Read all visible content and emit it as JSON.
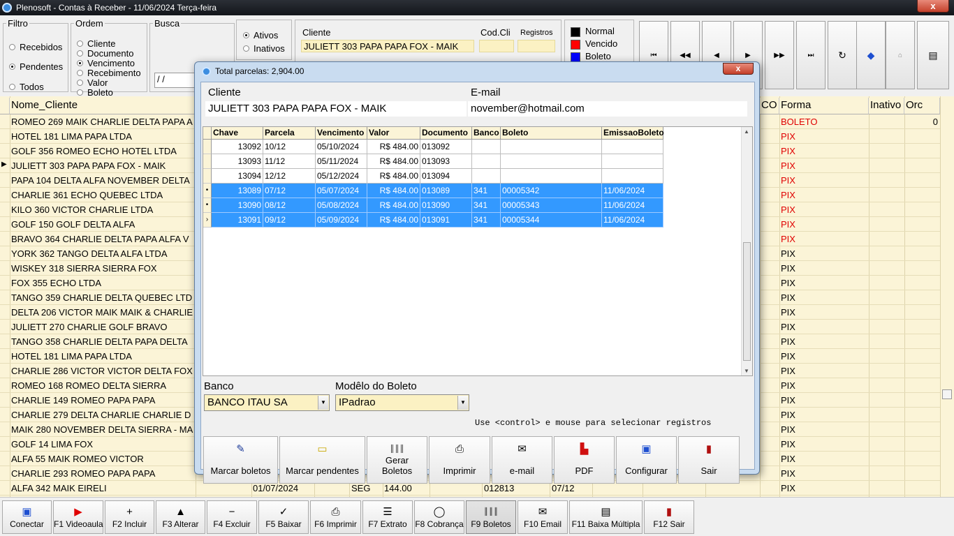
{
  "window": {
    "title": "Plenosoft - Contas à Receber - 11/06/2024 Terça-feira"
  },
  "filtro": {
    "label": "Filtro",
    "options": [
      "Recebidos",
      "Pendentes",
      "Todos"
    ],
    "selected": "Pendentes"
  },
  "ordem": {
    "label": "Ordem",
    "options": [
      "Cliente",
      "Documento",
      "Vencimento",
      "Recebimento",
      "Valor",
      "Boleto"
    ],
    "selected": "Vencimento"
  },
  "busca": {
    "label": "Busca",
    "value": "/ /"
  },
  "status": {
    "options": [
      "Ativos",
      "Inativos"
    ],
    "selected": "Ativos"
  },
  "cliente_panel": {
    "cliente_label": "Cliente",
    "cliente_value": "JULIETT 303 PAPA PAPA FOX - MAIK",
    "codcli_label": "Cod.Cli",
    "registros_label": "Registros"
  },
  "legend": [
    {
      "label": "Normal",
      "color": "#000000"
    },
    {
      "label": "Vencido",
      "color": "#ff0000"
    },
    {
      "label": "Boleto",
      "color": "#0000ff"
    }
  ],
  "main_grid": {
    "headers": {
      "nome": "Nome_Cliente",
      "co": "CO",
      "forma": "Forma",
      "inativo": "Inativo",
      "orc": "Orc"
    },
    "rows": [
      {
        "nome": "ROMEO 269 MAIK CHARLIE DELTA PAPA A",
        "forma": "BOLETO",
        "orc": "0",
        "red": true
      },
      {
        "nome": "HOTEL 181 LIMA PAPA LTDA",
        "forma": "PIX",
        "red": true
      },
      {
        "nome": "GOLF 356 ROMEO ECHO HOTEL LTDA",
        "forma": "PIX",
        "red": true
      },
      {
        "nome": "JULIETT 303 PAPA PAPA FOX - MAIK",
        "forma": "PIX",
        "red": true,
        "current": true
      },
      {
        "nome": "PAPA 104 DELTA ALFA NOVEMBER DELTA",
        "forma": "PIX",
        "red": true
      },
      {
        "nome": "CHARLIE 361 ECHO QUEBEC LTDA",
        "forma": "PIX",
        "red": true
      },
      {
        "nome": "KILO 360 VICTOR CHARLIE LTDA",
        "forma": "PIX",
        "red": true
      },
      {
        "nome": "GOLF 150 GOLF DELTA ALFA",
        "forma": "PIX",
        "red": true
      },
      {
        "nome": "BRAVO 364 CHARLIE DELTA PAPA ALFA V",
        "forma": "PIX",
        "red": true
      },
      {
        "nome": "YORK 362 TANGO DELTA ALFA LTDA",
        "forma": "PIX"
      },
      {
        "nome": "WISKEY 318 SIERRA SIERRA FOX",
        "forma": "PIX"
      },
      {
        "nome": "FOX 355 ECHO LTDA",
        "forma": "PIX"
      },
      {
        "nome": "TANGO 359 CHARLIE DELTA QUEBEC LTD",
        "forma": "PIX"
      },
      {
        "nome": "DELTA 206 VICTOR MAIK MAIK & CHARLIE",
        "forma": "PIX"
      },
      {
        "nome": "JULIETT 270 CHARLIE GOLF BRAVO",
        "forma": "PIX"
      },
      {
        "nome": "TANGO 358 CHARLIE DELTA PAPA DELTA",
        "forma": "PIX"
      },
      {
        "nome": "HOTEL 181 LIMA PAPA LTDA",
        "forma": "PIX"
      },
      {
        "nome": "CHARLIE 286 VICTOR VICTOR DELTA FOX",
        "forma": "PIX"
      },
      {
        "nome": "ROMEO 168 ROMEO DELTA SIERRA",
        "forma": "PIX"
      },
      {
        "nome": "CHARLIE 149 ROMEO PAPA PAPA",
        "forma": "PIX"
      },
      {
        "nome": "CHARLIE 279 DELTA CHARLIE CHARLIE D",
        "forma": "PIX"
      },
      {
        "nome": "MAIK 280 NOVEMBER DELTA SIERRA - MA",
        "forma": "PIX"
      },
      {
        "nome": "GOLF 14 LIMA FOX",
        "forma": "PIX"
      },
      {
        "nome": "ALFA 55 MAIK ROMEO VICTOR",
        "forma": "PIX"
      },
      {
        "nome": "CHARLIE 293 ROMEO PAPA PAPA",
        "forma": "PIX"
      },
      {
        "nome": "ALFA 342 MAIK EIRELI",
        "vencimento": "01/07/2024",
        "dia": "SEG",
        "valor": "144.00",
        "documento": "012813",
        "parcela": "07/12",
        "forma": "PIX"
      }
    ]
  },
  "dialog": {
    "title": "Total parcelas: 2,904.00",
    "close": "x",
    "cliente_label": "Cliente",
    "cliente_value": "JULIETT 303 PAPA PAPA FOX - MAIK",
    "email_label": "E-mail",
    "email_value": "november@hotmail.com",
    "grid_headers": {
      "chave": "Chave",
      "parcela": "Parcela",
      "vencimento": "Vencimento",
      "valor": "Valor",
      "documento": "Documento",
      "banco": "Banco",
      "boleto": "Boleto",
      "emissao": "EmissaoBoleto"
    },
    "rows": [
      {
        "chave": "13092",
        "parcela": "10/12",
        "vencimento": "05/10/2024",
        "valor": "R$ 484.00",
        "documento": "013092",
        "banco": "",
        "boleto": "",
        "emissao": "",
        "selected": false,
        "indicator": ""
      },
      {
        "chave": "13093",
        "parcela": "11/12",
        "vencimento": "05/11/2024",
        "valor": "R$ 484.00",
        "documento": "013093",
        "banco": "",
        "boleto": "",
        "emissao": "",
        "selected": false,
        "indicator": ""
      },
      {
        "chave": "13094",
        "parcela": "12/12",
        "vencimento": "05/12/2024",
        "valor": "R$ 484.00",
        "documento": "013094",
        "banco": "",
        "boleto": "",
        "emissao": "",
        "selected": false,
        "indicator": ""
      },
      {
        "chave": "13089",
        "parcela": "07/12",
        "vencimento": "05/07/2024",
        "valor": "R$ 484.00",
        "documento": "013089",
        "banco": "341",
        "boleto": "00005342",
        "emissao": "11/06/2024",
        "selected": true,
        "indicator": "•"
      },
      {
        "chave": "13090",
        "parcela": "08/12",
        "vencimento": "05/08/2024",
        "valor": "R$ 484.00",
        "documento": "013090",
        "banco": "341",
        "boleto": "00005343",
        "emissao": "11/06/2024",
        "selected": true,
        "indicator": "•"
      },
      {
        "chave": "13091",
        "parcela": "09/12",
        "vencimento": "05/09/2024",
        "valor": "R$ 484.00",
        "documento": "013091",
        "banco": "341",
        "boleto": "00005344",
        "emissao": "11/06/2024",
        "selected": true,
        "indicator": "›"
      }
    ],
    "banco_label": "Banco",
    "banco_value": "BANCO ITAU SA",
    "modelo_label": "Modêlo do Boleto",
    "modelo_value": "IPadrao",
    "hint": "Use <control> e mouse para selecionar registros",
    "buttons": [
      {
        "label": "Marcar boletos",
        "icon": "checklist-icon"
      },
      {
        "label": "Marcar pendentes",
        "icon": "page-icon"
      },
      {
        "label": "Gerar Boletos",
        "icon": "barcode-icon"
      },
      {
        "label": "Imprimir",
        "icon": "printer-icon"
      },
      {
        "label": "e-mail",
        "icon": "envelope-icon"
      },
      {
        "label": "PDF",
        "icon": "pdf-icon"
      },
      {
        "label": "Configurar",
        "icon": "config-icon"
      },
      {
        "label": "Sair",
        "icon": "exit-icon"
      }
    ]
  },
  "bottom_toolbar": [
    {
      "label": "Conectar",
      "icon": "connect-icon"
    },
    {
      "label": "F1 Videoaula",
      "icon": "video-icon"
    },
    {
      "label": "F2 Incluir",
      "icon": "plus-icon"
    },
    {
      "label": "F3 Alterar",
      "icon": "up-arrow-icon"
    },
    {
      "label": "F4 Excluir",
      "icon": "minus-icon"
    },
    {
      "label": "F5 Baixar",
      "icon": "check-icon"
    },
    {
      "label": "F6 Imprimir",
      "icon": "printer-icon"
    },
    {
      "label": "F7 Extrato",
      "icon": "list-icon"
    },
    {
      "label": "F8 Cobrança",
      "icon": "speech-icon"
    },
    {
      "label": "F9 Boletos",
      "icon": "barcode-icon",
      "pressed": true
    },
    {
      "label": "F10 Email",
      "icon": "envelope-icon"
    },
    {
      "label": "F11 Baixa Múltipla",
      "icon": "stack-icon"
    },
    {
      "label": "F12 Sair",
      "icon": "exit-icon"
    }
  ]
}
